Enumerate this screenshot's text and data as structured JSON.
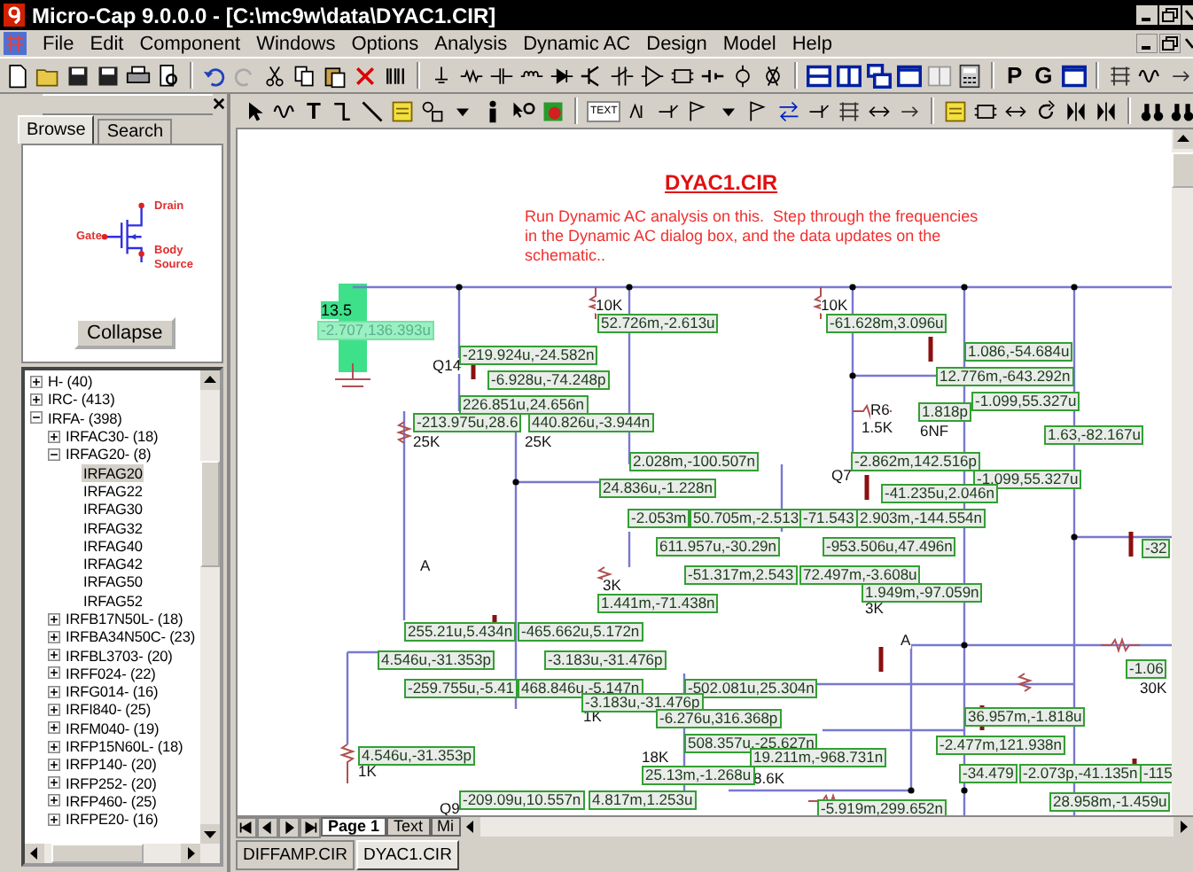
{
  "window": {
    "title": "Micro-Cap 9.0.0.0 - [C:\\mc9w\\data\\DYAC1.CIR]"
  },
  "menu": [
    "File",
    "Edit",
    "Component",
    "Windows",
    "Options",
    "Analysis",
    "Dynamic AC",
    "Design",
    "Model",
    "Help"
  ],
  "toolbar": {
    "text_buttons": [
      "P",
      "G",
      "T",
      "TEXT"
    ]
  },
  "browser": {
    "tabs": [
      {
        "label": "Browse",
        "selected": true
      },
      {
        "label": "Search",
        "selected": false
      }
    ],
    "pins": [
      "Drain",
      "Gate",
      "Body",
      "Source"
    ],
    "collapse_button": "Collapse",
    "tree": [
      {
        "label": "H- (40)",
        "kind": "group",
        "expanded": false,
        "selected": false
      },
      {
        "label": "IRC- (413)",
        "kind": "group",
        "expanded": false,
        "selected": false
      },
      {
        "label": "IRFA- (398)",
        "kind": "group",
        "expanded": true,
        "selected": false,
        "children": [
          {
            "label": "IRFAC30- (18)",
            "kind": "group",
            "expanded": false,
            "selected": false
          },
          {
            "label": "IRFAG20- (8)",
            "kind": "group",
            "expanded": true,
            "selected": false,
            "children": [
              {
                "label": "IRFAG20",
                "kind": "part",
                "selected": true
              },
              {
                "label": "IRFAG22",
                "kind": "part",
                "selected": false
              },
              {
                "label": "IRFAG30",
                "kind": "part",
                "selected": false
              },
              {
                "label": "IRFAG32",
                "kind": "part",
                "selected": false
              },
              {
                "label": "IRFAG40",
                "kind": "part",
                "selected": false
              },
              {
                "label": "IRFAG42",
                "kind": "part",
                "selected": false
              },
              {
                "label": "IRFAG50",
                "kind": "part",
                "selected": false
              },
              {
                "label": "IRFAG52",
                "kind": "part",
                "selected": false
              }
            ]
          },
          {
            "label": "IRFB17N50L- (18)",
            "kind": "group",
            "expanded": false,
            "selected": false
          },
          {
            "label": "IRFBA34N50C- (23)",
            "kind": "group",
            "expanded": false,
            "selected": false
          },
          {
            "label": "IRFBL3703- (20)",
            "kind": "group",
            "expanded": false,
            "selected": false
          },
          {
            "label": "IRFF024- (22)",
            "kind": "group",
            "expanded": false,
            "selected": false
          },
          {
            "label": "IRFG014- (16)",
            "kind": "group",
            "expanded": false,
            "selected": false
          },
          {
            "label": "IRFI840- (25)",
            "kind": "group",
            "expanded": false,
            "selected": false
          },
          {
            "label": "IRFM040- (19)",
            "kind": "group",
            "expanded": false,
            "selected": false
          },
          {
            "label": "IRFP15N60L- (18)",
            "kind": "group",
            "expanded": false,
            "selected": false
          },
          {
            "label": "IRFP140- (20)",
            "kind": "group",
            "expanded": false,
            "selected": false
          },
          {
            "label": "IRFP252- (20)",
            "kind": "group",
            "expanded": false,
            "selected": false
          },
          {
            "label": "IRFP460- (25)",
            "kind": "group",
            "expanded": false,
            "selected": false
          },
          {
            "label": "IRFPE20- (16)",
            "kind": "group",
            "expanded": false,
            "selected": false
          }
        ]
      }
    ]
  },
  "schematic": {
    "title": "DYAC1.CIR",
    "note": [
      "Run Dynamic AC analysis on this.  Step through the frequencies",
      "in the Dynamic AC dialog box, and the data updates on the",
      "schematic.."
    ],
    "node_label": {
      "text": "13.5",
      "selected": true
    },
    "values": [
      {
        "text": "-2.707,136.393u",
        "selected": true
      },
      {
        "text": "52.726m,-2.613u",
        "selected": false
      },
      {
        "text": "-219.924u,-24.582n",
        "selected": false
      },
      {
        "text": "-6.928u,-74.248p",
        "selected": false
      },
      {
        "text": "226.851u,24.656n",
        "selected": false
      },
      {
        "text": "-213.975u,28.6",
        "selected": false
      },
      {
        "text": "440.826u,-3.944n",
        "selected": false
      },
      {
        "text": "2.028m,-100.507n",
        "selected": false
      },
      {
        "text": "24.836u,-1.228n",
        "selected": false
      },
      {
        "text": "-61.628m,3.096u",
        "selected": false
      },
      {
        "text": "1.086,-54.684u",
        "selected": false
      },
      {
        "text": "12.776m,-643.292n",
        "selected": false
      },
      {
        "text": "1.818p",
        "selected": false
      },
      {
        "text": "-1.099,55.327u",
        "selected": false
      },
      {
        "text": "1.63,-82.167u",
        "selected": false
      },
      {
        "text": "-2.862m,142.516p",
        "selected": false
      },
      {
        "text": "-1.099,55.327u",
        "selected": false
      },
      {
        "text": "-41.235u,2.046n",
        "selected": false
      },
      {
        "text": "-2.053m",
        "selected": false
      },
      {
        "text": "50.705m,-2.513",
        "selected": false
      },
      {
        "text": "-71.543",
        "selected": false
      },
      {
        "text": "2.903m,-144.554n",
        "selected": false
      },
      {
        "text": "611.957u,-30.29n",
        "selected": false
      },
      {
        "text": "-953.506u,47.496n",
        "selected": false
      },
      {
        "text": "-32",
        "selected": false
      },
      {
        "text": "-51.317m,2.543",
        "selected": false
      },
      {
        "text": "72.497m,-3.608u",
        "selected": false
      },
      {
        "text": "1.949m,-97.059n",
        "selected": false
      },
      {
        "text": "1.441m,-71.438n",
        "selected": false
      },
      {
        "text": "255.21u,5.434n",
        "selected": false
      },
      {
        "text": "-465.662u,5.172n",
        "selected": false
      },
      {
        "text": "4.546u,-31.353p",
        "selected": false
      },
      {
        "text": "-3.183u,-31.476p",
        "selected": false
      },
      {
        "text": "-1.06",
        "selected": false
      },
      {
        "text": "-259.755u,-5.41",
        "selected": false
      },
      {
        "text": "468.846u,-5.147n",
        "selected": false
      },
      {
        "text": "-502.081u,25.304n",
        "selected": false
      },
      {
        "text": "-3.183u,-31.476p",
        "selected": false
      },
      {
        "text": "-6.276u,316.368p",
        "selected": false
      },
      {
        "text": "36.957m,-1.818u",
        "selected": false
      },
      {
        "text": "508.357u,-25.627n",
        "selected": false
      },
      {
        "text": "-2.477m,121.938n",
        "selected": false
      },
      {
        "text": "4.546u,-31.353p",
        "selected": false
      },
      {
        "text": "19.211m,-968.731n",
        "selected": false
      },
      {
        "text": "25.13m,-1.268u",
        "selected": false
      },
      {
        "text": "-34.479",
        "selected": false
      },
      {
        "text": "-2.073p,-41.135n",
        "selected": false
      },
      {
        "text": "-115",
        "selected": false
      },
      {
        "text": "-209.09u,10.557n",
        "selected": false
      },
      {
        "text": "4.817m,1.253u",
        "selected": false
      },
      {
        "text": "28.958m,-1.459u",
        "selected": false
      },
      {
        "text": "-5.919m,299.652n",
        "selected": false
      }
    ],
    "parts": [
      "10K",
      "Q14",
      "25K",
      "25K",
      "10K",
      "R6",
      "1.5K",
      "6NF",
      "Q7",
      "A",
      "3K",
      "3K",
      "A",
      "30K",
      "1K",
      "1K",
      "18K",
      "8.6K",
      "Q9"
    ]
  },
  "page_tabs": [
    {
      "label": "Page 1",
      "selected": true
    },
    {
      "label": "Text",
      "selected": false
    },
    {
      "label": "Mi",
      "selected": false
    }
  ],
  "file_tabs": [
    {
      "label": "DIFFAMP.CIR",
      "selected": false
    },
    {
      "label": "DYAC1.CIR",
      "selected": true
    }
  ]
}
